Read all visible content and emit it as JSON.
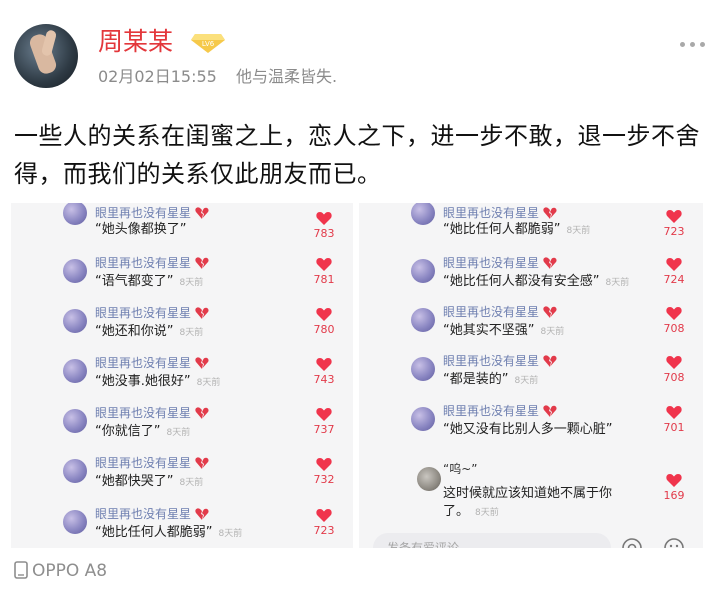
{
  "post": {
    "username": "周某某",
    "vip_badge": "LV6",
    "time": "02月02日15:55",
    "source": "他与温柔皆失.",
    "content": "一些人的关系在闺蜜之上，恋人之下，进一步不敢，退一步不舍得，而我们的关系仅此朋友而已。",
    "device": "OPPO A8"
  },
  "left_comments": [
    {
      "name": "眼里再也没有星星",
      "text": "“她头像都换了”",
      "ago": "",
      "likes": "783"
    },
    {
      "name": "眼里再也没有星星",
      "text": "“语气都变了”",
      "ago": "8天前",
      "likes": "781"
    },
    {
      "name": "眼里再也没有星星",
      "text": "“她还和你说”",
      "ago": "8天前",
      "likes": "780"
    },
    {
      "name": "眼里再也没有星星",
      "text": "“她没事.她很好”",
      "ago": "8天前",
      "likes": "743"
    },
    {
      "name": "眼里再也没有星星",
      "text": "“你就信了”",
      "ago": "8天前",
      "likes": "737"
    },
    {
      "name": "眼里再也没有星星",
      "text": "“她都快哭了”",
      "ago": "8天前",
      "likes": "732"
    },
    {
      "name": "眼里再也没有星星",
      "text": "“她比任何人都脆弱”",
      "ago": "8天前",
      "likes": "723"
    }
  ],
  "right_comments": [
    {
      "name": "眼里再也没有星星",
      "text": "“她比任何人都脆弱”",
      "ago": "8天前",
      "likes": "723"
    },
    {
      "name": "眼里再也没有星星",
      "text": "“她比任何人都没有安全感”",
      "ago": "8天前",
      "likes": "724"
    },
    {
      "name": "眼里再也没有星星",
      "text": "“她其实不坚强”",
      "ago": "8天前",
      "likes": "708"
    },
    {
      "name": "眼里再也没有星星",
      "text": "“都是装的”",
      "ago": "8天前",
      "likes": "708"
    },
    {
      "name": "眼里再也没有星星",
      "text": "“她又没有比别人多一颗心脏”",
      "ago": "",
      "likes": "701"
    }
  ],
  "right_last": {
    "name": "“呜~”",
    "line1": "这时候就应该知道她不属于你",
    "line2": "了。",
    "ago": "8天前",
    "likes": "169"
  },
  "reply_placeholder": "发条有爱评论",
  "icons": {
    "more": "more-dots-icon",
    "vip": "vip-diamond-icon",
    "like": "heart-icon",
    "broken_heart": "broken-heart-icon",
    "phone": "phone-icon"
  },
  "colors": {
    "username": "#e3373b",
    "like": "#f0344c",
    "commenter": "#6e7fb0"
  }
}
